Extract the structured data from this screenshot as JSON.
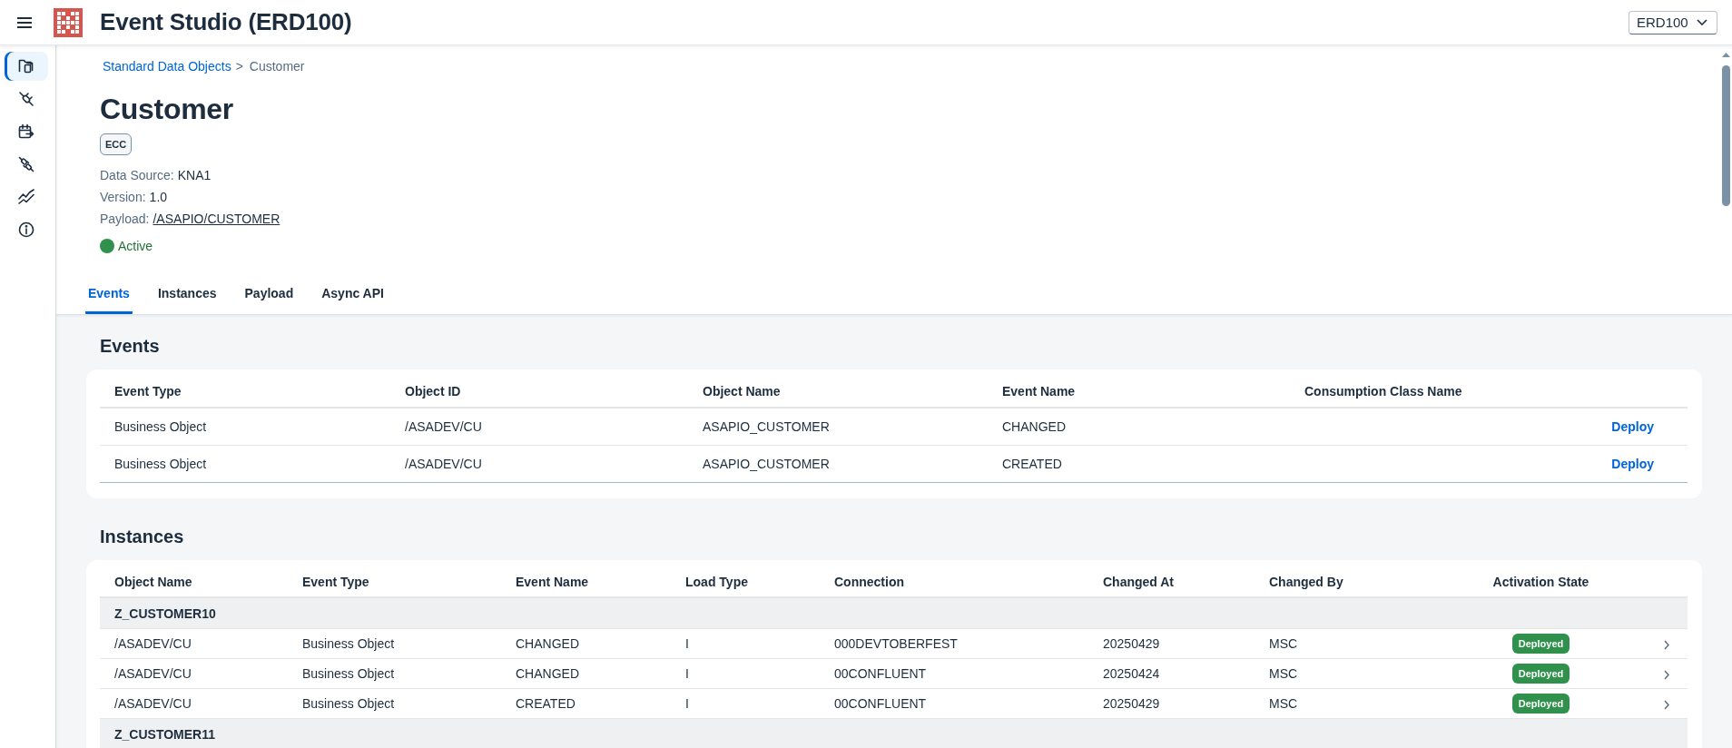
{
  "shell_bar": {
    "title": "Event Studio (ERD100)",
    "system": {
      "value": "ERD100"
    }
  },
  "sidebar": {
    "items": [
      {
        "selected": true
      },
      {
        "selected": false
      },
      {
        "selected": false
      },
      {
        "selected": false
      },
      {
        "selected": false
      },
      {
        "selected": false
      }
    ]
  },
  "breadcrumb": {
    "items": [
      {
        "label": "Standard Data Objects",
        "kind": "link"
      },
      {
        "label": "Customer",
        "kind": "current"
      }
    ],
    "separator": ">"
  },
  "object": {
    "title": "Customer",
    "tag": "ECC",
    "fields": [
      {
        "label": "Data Source:",
        "value": "KNA1",
        "kind": "text"
      },
      {
        "label": "Version:",
        "value": "1.0",
        "kind": "text"
      },
      {
        "label": "Payload:",
        "value": "/ASAPIO/CUSTOMER",
        "kind": "link"
      }
    ],
    "status": {
      "label": "Active",
      "kind": "positive"
    }
  },
  "tabs": [
    {
      "label": "Events",
      "selected": true
    },
    {
      "label": "Instances",
      "selected": false
    },
    {
      "label": "Payload",
      "selected": false
    },
    {
      "label": "Async API",
      "selected": false
    }
  ],
  "events": {
    "title": "Events",
    "columns": [
      "Event Type",
      "Object ID",
      "Object Name",
      "Event Name",
      "Consumption Class Name"
    ],
    "rows": [
      {
        "cells": [
          "Business Object",
          "/ASADEV/CU",
          "ASAPIO_CUSTOMER",
          "CHANGED"
        ],
        "action": "Deploy"
      },
      {
        "cells": [
          "Business Object",
          "/ASADEV/CU",
          "ASAPIO_CUSTOMER",
          "CREATED"
        ],
        "action": "Deploy"
      }
    ]
  },
  "instances": {
    "title": "Instances",
    "columns": [
      "Object Name",
      "Event Type",
      "Event Name",
      "Load Type",
      "Connection",
      "Changed At",
      "Changed By",
      "Activation State"
    ],
    "groups": [
      {
        "name": "Z_CUSTOMER10",
        "rows": [
          {
            "cells": [
              "/ASADEV/CU",
              "Business Object",
              "CHANGED",
              "I",
              "000DEVTOBERFEST",
              "20250429",
              "MSC"
            ],
            "state": {
              "label": "Deployed",
              "kind": "success"
            }
          },
          {
            "cells": [
              "/ASADEV/CU",
              "Business Object",
              "CHANGED",
              "I",
              "00CONFLUENT",
              "20250424",
              "MSC"
            ],
            "state": {
              "label": "Deployed",
              "kind": "success"
            }
          },
          {
            "cells": [
              "/ASADEV/CU",
              "Business Object",
              "CREATED",
              "I",
              "00CONFLUENT",
              "20250429",
              "MSC"
            ],
            "state": {
              "label": "Deployed",
              "kind": "success"
            }
          }
        ]
      },
      {
        "name": "Z_CUSTOMER11"
      }
    ]
  }
}
